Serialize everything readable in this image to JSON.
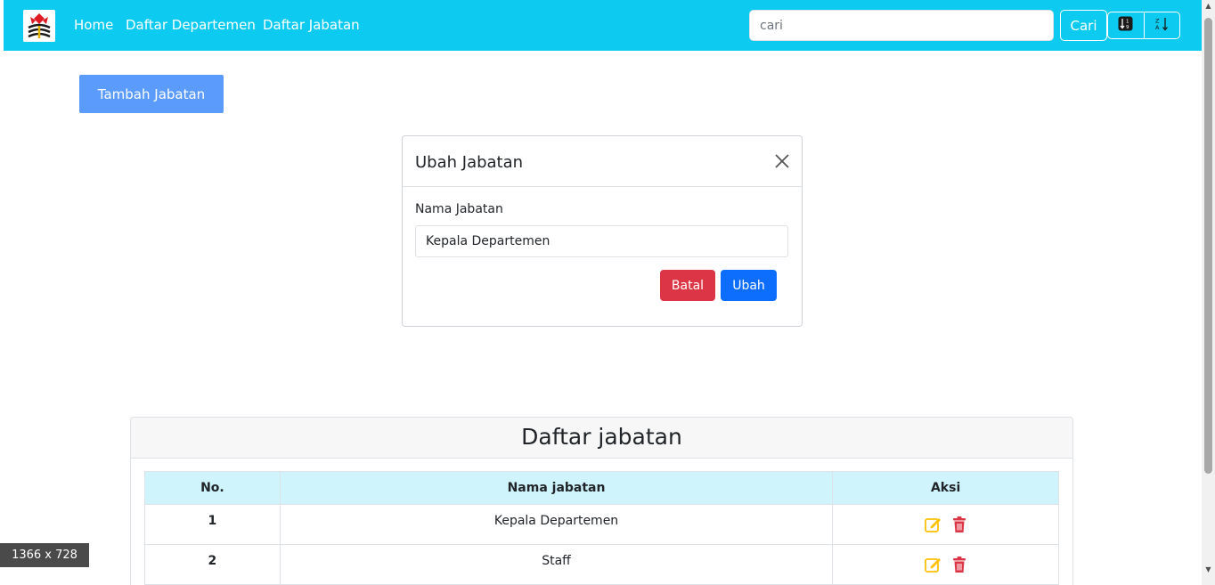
{
  "navbar": {
    "links": [
      "Home",
      "Daftar Departemen",
      "Daftar Jabatan"
    ],
    "search_placeholder": "cari",
    "search_button": "Cari"
  },
  "toolbar": {
    "add_button": "Tambah Jabatan"
  },
  "modal": {
    "title": "Ubah Jabatan",
    "label": "Nama Jabatan",
    "input_value": "Kepala Departemen",
    "cancel_button": "Batal",
    "submit_button": "Ubah"
  },
  "table": {
    "title": "Daftar jabatan",
    "headers": [
      "No.",
      "Nama jabatan",
      "Aksi"
    ],
    "rows": [
      {
        "no": "1",
        "name": "Kepala Departemen"
      },
      {
        "no": "2",
        "name": "Staff"
      }
    ]
  },
  "size_badge": "1366 x 728",
  "colors": {
    "navbar": "#0dcaf0",
    "danger": "#dc3545",
    "primary": "#0d6efd",
    "edit": "#ffc107"
  },
  "icons": [
    "logo-icon",
    "close-icon",
    "sort-numeric-icon",
    "sort-alpha-icon",
    "edit-icon",
    "trash-icon"
  ]
}
